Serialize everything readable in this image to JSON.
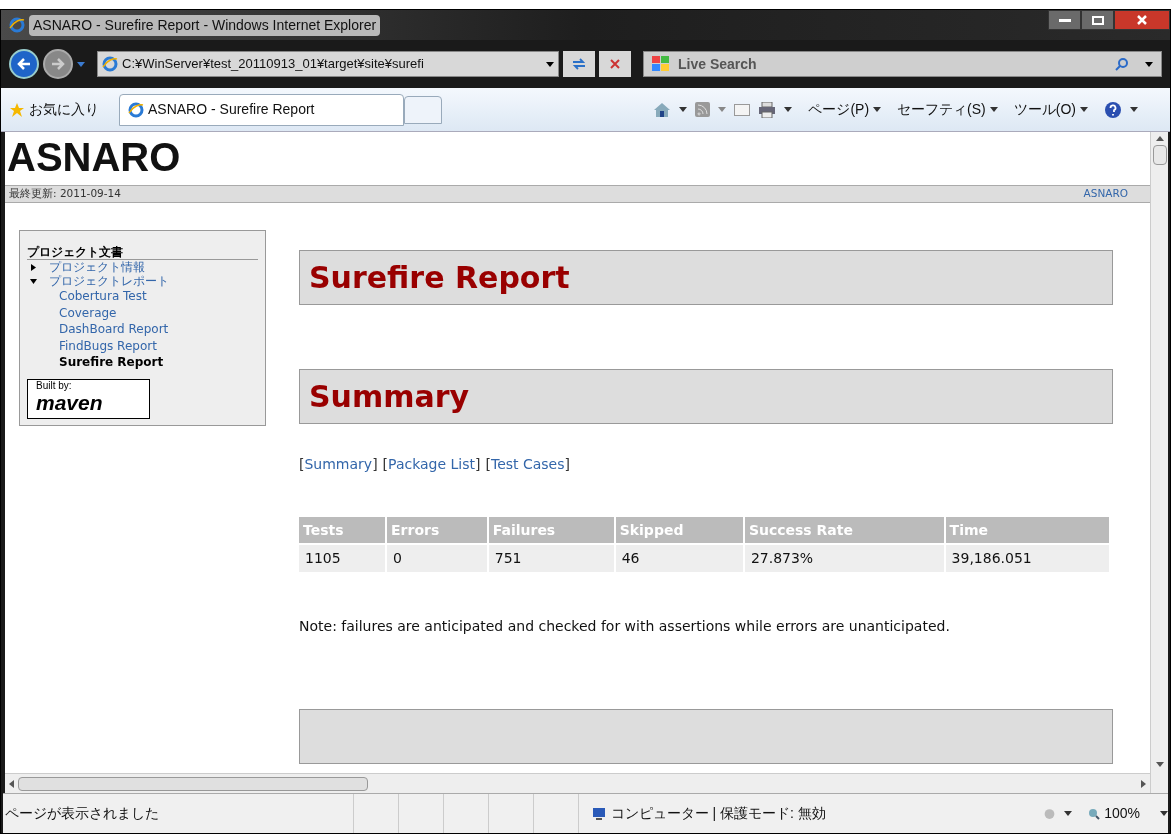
{
  "window": {
    "title": "ASNARO - Surefire Report - Windows Internet Explorer"
  },
  "address_bar": {
    "value": "C:¥WinServer¥test_20110913_01¥target¥site¥surefi"
  },
  "search": {
    "placeholder": "Live Search"
  },
  "favorites": {
    "label": "お気に入り"
  },
  "tabs": [
    {
      "label": "ASNARO - Surefire Report",
      "selected": true
    }
  ],
  "command_bar": [
    "ページ(P)",
    "セーフティ(S)",
    "ツール(O)"
  ],
  "page": {
    "logo": "ASNARO",
    "last_updated": "最終更新: 2011-09-14",
    "top_link": "ASNARO",
    "sidebar": {
      "heading": "プロジェクト文書",
      "items": [
        {
          "label": "プロジェクト情報",
          "expanded": false
        },
        {
          "label": "プロジェクトレポート",
          "expanded": true,
          "children": [
            {
              "label": "Cobertura Test Coverage",
              "selected": false
            },
            {
              "label": "DashBoard Report",
              "selected": false
            },
            {
              "label": "FindBugs Report",
              "selected": false
            },
            {
              "label": "Surefire Report",
              "selected": true
            }
          ]
        }
      ],
      "badge": {
        "line1": "Built by:",
        "line2": "maven"
      }
    },
    "title": "Surefire Report",
    "section": "Summary",
    "links": [
      {
        "open": "[",
        "label": "Summary",
        "close": "]"
      },
      {
        "open": "[",
        "label": "Package List",
        "close": "]"
      },
      {
        "open": "[",
        "label": "Test Cases",
        "close": "]"
      }
    ],
    "table": {
      "columns": [
        "Tests",
        "Errors",
        "Failures",
        "Skipped",
        "Success Rate",
        "Time"
      ],
      "rows": [
        [
          "1105",
          "0",
          "751",
          "46",
          "27.873%",
          "39,186.051"
        ]
      ]
    },
    "note": "Note: failures are anticipated and checked for with assertions while errors are unanticipated."
  },
  "status_bar": {
    "message": "ページが表示されました",
    "zone": "コンピューター | 保護モード: 無効",
    "zoom": "100%"
  }
}
